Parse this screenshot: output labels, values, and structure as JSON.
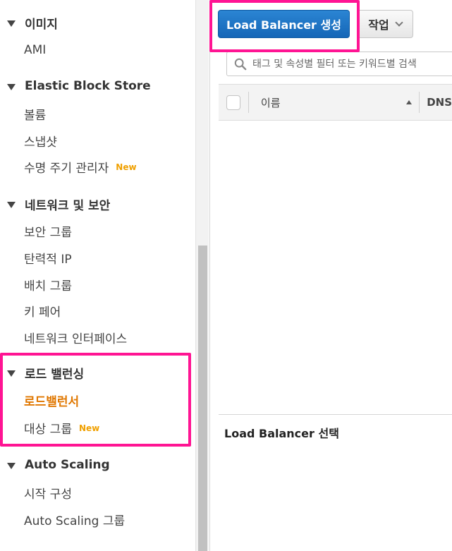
{
  "sidebar": {
    "sections": [
      {
        "title": "이미지",
        "items": [
          {
            "label": "AMI"
          }
        ]
      },
      {
        "title": "Elastic Block Store",
        "items": [
          {
            "label": "볼륨"
          },
          {
            "label": "스냅샷"
          },
          {
            "label": "수명 주기 관리자",
            "badge": "New"
          }
        ]
      },
      {
        "title": "네트워크 및 보안",
        "items": [
          {
            "label": "보안 그룹"
          },
          {
            "label": "탄력적 IP"
          },
          {
            "label": "배치 그룹"
          },
          {
            "label": "키 페어"
          },
          {
            "label": "네트워크 인터페이스"
          }
        ]
      },
      {
        "title": "로드 밸런싱",
        "items": [
          {
            "label": "로드밸런서",
            "active": true
          },
          {
            "label": "대상 그룹",
            "badge": "New"
          }
        ]
      },
      {
        "title": "Auto Scaling",
        "items": [
          {
            "label": "시작 구성"
          },
          {
            "label": "Auto Scaling 그룹"
          }
        ]
      }
    ]
  },
  "toolbar": {
    "create_label": "Load Balancer 생성",
    "actions_label": "작업"
  },
  "search": {
    "placeholder": "태그 및 속성별 필터 또는 키워드별 검색"
  },
  "table": {
    "columns": [
      "이름",
      "DNS"
    ]
  },
  "detail": {
    "title": "Load Balancer 선택"
  },
  "colors": {
    "primary": "#1f74c6",
    "active_nav": "#e07700",
    "badge": "#f0a000",
    "highlight": "#ff1493"
  }
}
